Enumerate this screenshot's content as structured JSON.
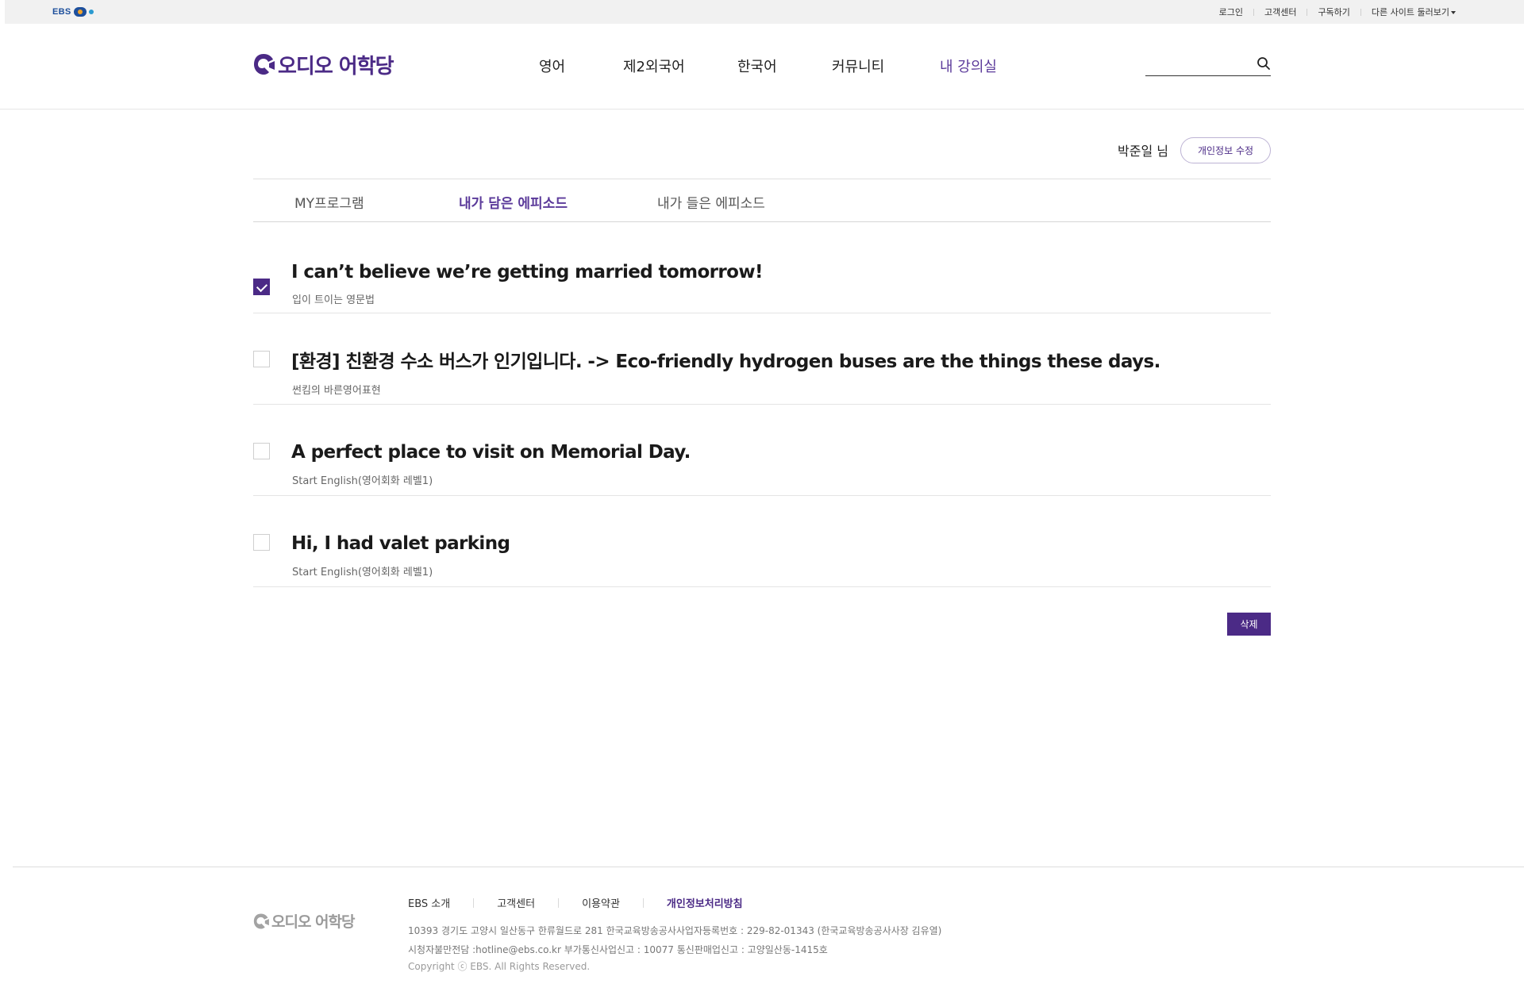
{
  "topbar": {
    "ebs_logo": "EBS",
    "links": [
      "로그인",
      "고객센터",
      "구독하기",
      "다른 사이트 둘러보기"
    ]
  },
  "header": {
    "logo_text": "오디오 어학당",
    "nav": [
      "영어",
      "제2외국어",
      "한국어",
      "커뮤니티",
      "내 강의실"
    ],
    "active_nav": "내 강의실",
    "search": {
      "value": "",
      "placeholder": ""
    }
  },
  "user": {
    "name": "박준일 님",
    "edit_button": "개인정보 수정"
  },
  "tabs": [
    "MY프로그램",
    "내가 담은 에피소드",
    "내가 들은 에피소드"
  ],
  "active_tab": "내가 담은 에피소드",
  "episodes": [
    {
      "title": "I can’t believe we’re getting married tomorrow!",
      "program": "입이 트이는 영문법",
      "checked": true
    },
    {
      "title": "[환경] 친환경 수소 버스가 인기입니다. -> Eco-friendly hydrogen buses are the things these days.",
      "program": "썬킴의 바른영어표현",
      "checked": false
    },
    {
      "title": "A perfect place to visit on Memorial Day.",
      "program": "Start English(영어회화 레벨1)",
      "checked": false
    },
    {
      "title": "Hi, I had valet parking",
      "program": "Start English(영어회화 레벨1)",
      "checked": false
    }
  ],
  "delete_button": "삭제",
  "footer": {
    "logo_text": "오디오 어학당",
    "links": [
      "EBS 소개",
      "고객센터",
      "이용약관",
      "개인정보처리방침"
    ],
    "address": "10393 경기도 고양시 일산동구 한류월드로 281 한국교육방송공사사업자등록번호 : 229-82-01343 (한국교육방송공사사장 김유열)",
    "contact": "시청자불만전담 :hotline@ebs.co.kr 부가통신사업신고 : 10077 통신판매업신고 : 고양일산동-1415호",
    "copyright": "Copyright ⓒ EBS. All Rights Reserved."
  },
  "colors": {
    "brand": "#4b2a86",
    "active_text": "#5b3a9a",
    "topbar_bg": "#f1f1f1"
  }
}
